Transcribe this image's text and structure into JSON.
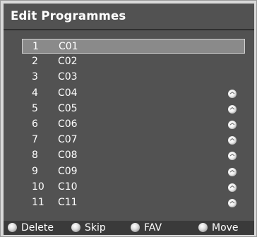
{
  "title": "Edit Programmes",
  "programmes": [
    {
      "number": "1",
      "name": "C01",
      "selected": true,
      "has_icon": false
    },
    {
      "number": "2",
      "name": "C02",
      "selected": false,
      "has_icon": false
    },
    {
      "number": "3",
      "name": "C03",
      "selected": false,
      "has_icon": false
    },
    {
      "number": "4",
      "name": "C04",
      "selected": false,
      "has_icon": true
    },
    {
      "number": "5",
      "name": "C05",
      "selected": false,
      "has_icon": true
    },
    {
      "number": "6",
      "name": "C06",
      "selected": false,
      "has_icon": true
    },
    {
      "number": "7",
      "name": "C07",
      "selected": false,
      "has_icon": true
    },
    {
      "number": "8",
      "name": "C08",
      "selected": false,
      "has_icon": true
    },
    {
      "number": "9",
      "name": "C09",
      "selected": false,
      "has_icon": true
    },
    {
      "number": "10",
      "name": "C10",
      "selected": false,
      "has_icon": true
    },
    {
      "number": "11",
      "name": "C11",
      "selected": false,
      "has_icon": true
    }
  ],
  "footer": {
    "delete_label": "Delete",
    "skip_label": "Skip",
    "fav_label": "FAV",
    "move_label": "Move"
  },
  "icons": {
    "row_icon": "status-indicator-icon",
    "footer_icon": "remote-button-icon"
  },
  "colors": {
    "panel": "#525252",
    "selected_row": "#8a8a8a",
    "footer": "#3a3a3a",
    "text": "#ffffff"
  }
}
